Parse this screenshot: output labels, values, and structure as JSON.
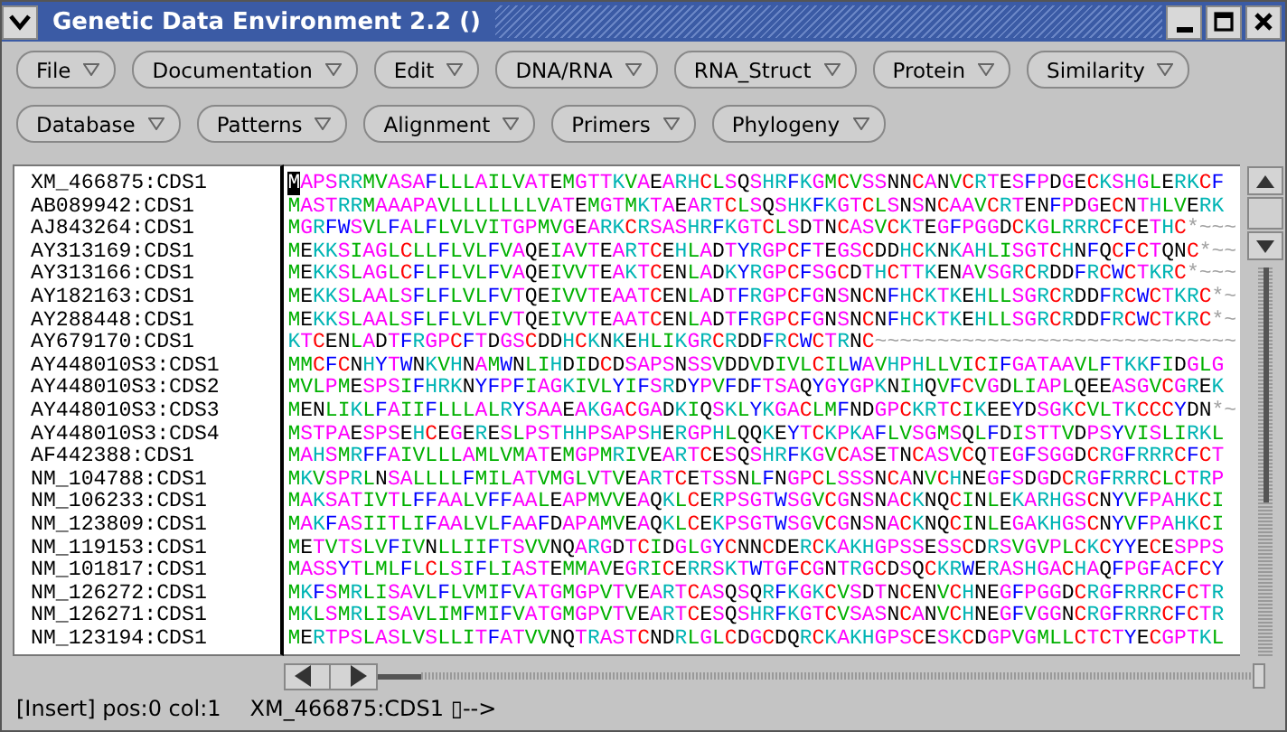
{
  "window": {
    "title": "Genetic Data Environment 2.2 ()"
  },
  "menu_rows": [
    {
      "items": [
        {
          "label": "File"
        },
        {
          "label": "Documentation"
        },
        {
          "label": "Edit"
        },
        {
          "label": "DNA/RNA"
        },
        {
          "label": "RNA_Struct"
        },
        {
          "label": "Protein"
        },
        {
          "label": "Similarity"
        }
      ]
    },
    {
      "items": [
        {
          "label": "Database"
        },
        {
          "label": "Patterns"
        },
        {
          "label": "Alignment"
        },
        {
          "label": "Primers"
        },
        {
          "label": "Phylogeny"
        }
      ]
    }
  ],
  "sequences": [
    {
      "name": "XM_466875:CDS1",
      "residues": "MAPSRRMVASAFLLLAILVATEMGTTKVAEARHCLSQSHRFKGMCVSSNNCANVCRTESFPDGECKSHGLERKCF",
      "has_cursor": true
    },
    {
      "name": "AB089942:CDS1",
      "residues": "MASTRRMAAAPAVLLLLLLLVATEMGTMKTAEARTCLSQSHKFKGTCLSNSNCAAVCRTENFPDGECNTHLVERK",
      "has_cursor": false
    },
    {
      "name": "AJ843264:CDS1",
      "residues": "MGRFWSVLFALFLVLVITGPMVGEARKCRSASHRFKGTCLSDTNCASVCKTEGFPGGDCKGLRRRCFCETHC*~~~",
      "has_cursor": false
    },
    {
      "name": "AY313169:CDS1",
      "residues": "MEKKSIAGLCLLFLVLFVAQEIAVTEARTCEHLADTYRGPCFTEGSCDDHCKNKAHLISGTCHNFQCFCTQNC*~~",
      "has_cursor": false
    },
    {
      "name": "AY313166:CDS1",
      "residues": "MEKKSLAGLCFLFLVLFVAQEIVVTEAKTCENLADKYRGPCFSGCDTHCTTKENAVSGRCRDDFRCWCTKRC*~~~",
      "has_cursor": false
    },
    {
      "name": "AY182163:CDS1",
      "residues": "MEKKSLAALSFLFLVLFVTQEIVVTEAATCENLADTFRGPCFGNSNCNFHCKTKEHLLSGRCRDDFRCWCTKRC*~",
      "has_cursor": false
    },
    {
      "name": "AY288448:CDS1",
      "residues": "MEKKSLAALSFLFLVLFVTQEIVVTEAATCENLADTFRGPCFGNSNCNFHCKTKEHLLSGRCRDDFRCWCTKRC*~",
      "has_cursor": false
    },
    {
      "name": "AY679170:CDS1",
      "residues": "KTCENLADTFRGPCFTDGSCDDHCKNKEHLIKGRCRDDFRCWCTRNC~~~~~~~~~~~~~~~~~~~~~~~~~~~~~",
      "has_cursor": false
    },
    {
      "name": "AY448010S3:CDS1",
      "residues": "MMCFCNHYTWNKVHNAMWNLIHDIDCDSAPSNSSVDDVDIVLCILWAVHPHLLVICIFGATAAVLFTKKFIDGLG",
      "has_cursor": false
    },
    {
      "name": "AY448010S3:CDS2",
      "residues": "MVLPMESPSIFHRKNYFPFIAGKIVLYIFSRDYPVFDFTSAQYGYGPKNIHQVFCVGDLIAPLQEEASGVCGREK",
      "has_cursor": false
    },
    {
      "name": "AY448010S3:CDS3",
      "residues": "MENLIKLFAIIFLLLALRYSAAEAKGACGADKIQSKLYKGACLMFNDGPCKRTCIKEEYDSGKCVLTKCCCYDN*~",
      "has_cursor": false
    },
    {
      "name": "AY448010S3:CDS4",
      "residues": "MSTPAESPSEHCEGERESLPSTHHPSAPSHERGPHLQQKEYTCKPKAFLVSGMSQLFDISTTVDPSYVISLIRKL",
      "has_cursor": false
    },
    {
      "name": "AF442388:CDS1",
      "residues": "MAHSMRFFAIVLLLAMLVMATEMGPMRIVEARTCESQSHRFKGVCASETNCASVCQTEGFSGGDCRGFRRRCFCT",
      "has_cursor": false
    },
    {
      "name": "NM_104788:CDS1",
      "residues": "MKVSPRLNSALLLLFMILATVMGLVTVEARTCETSSNLFNGPCLSSSNCANVCHNEGFSDGDCRGFRRRCLCTRP",
      "has_cursor": false
    },
    {
      "name": "NM_106233:CDS1",
      "residues": "MAKSATIVTLFFAALVFFAALEAPMVVEAQKLCERPSGTWSGVCGNSNACKNQCINLEKARHGSCNYVFPAHKCI",
      "has_cursor": false
    },
    {
      "name": "NM_123809:CDS1",
      "residues": "MAKFASIITLIFAALVLFAAFDAPAMVEAQKLCEKPSGTWSGVCGNSNACKNQCINLEGAKHGSCNYVFPAHKCI",
      "has_cursor": false
    },
    {
      "name": "NM_119153:CDS1",
      "residues": "METVTSLVFIVNLLIIFTSVVNQARGDTCIDGLGYCNNCDERCKAKHGPSSESSCDRSVGVPLCKCYYECESPPS",
      "has_cursor": false
    },
    {
      "name": "NM_101817:CDS1",
      "residues": "MASSYTLMLFLCLSIFLIASTEMMAVEGRICERRSKTWTGFCGNTRGCDSQCKRWERASHGACHAQFPGFACFCY",
      "has_cursor": false
    },
    {
      "name": "NM_126272:CDS1",
      "residues": "MKFSMRLISAVLFLVMIFVATGMGPVTVEARTCASQSQRFKGKCVSDTNCENVCHNEGFPGGDCRGFRRRCFCTR",
      "has_cursor": false
    },
    {
      "name": "NM_126271:CDS1",
      "residues": "MKLSMRLISAVLIMFMIFVATGMGPVTVEARTCESQSHRFKGTCVSASNCANVCHNEGFVGGNCRGFRRRCFCTR",
      "has_cursor": false
    },
    {
      "name": "NM_123194:CDS1",
      "residues": "MERTPSLASLVSLLITFATVVNQTRASTCNDRLGLCDGCDQRCKAKHGPSCESKCDGPVGMLLCTCTYECGPTKL",
      "has_cursor": false
    }
  ],
  "status_bar": {
    "mode": "[Insert] pos:0 col:1",
    "sequence": "XM_466875:CDS1 ▯-->"
  }
}
